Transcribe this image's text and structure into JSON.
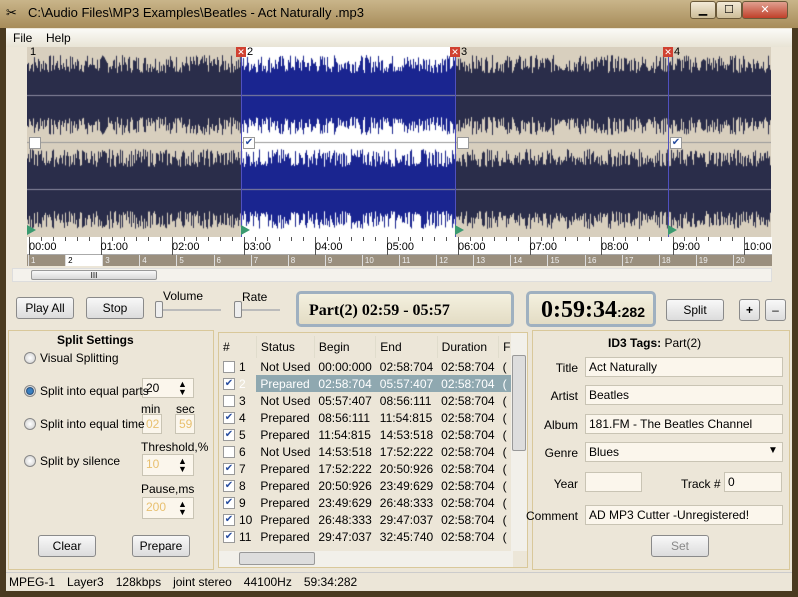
{
  "window": {
    "title": "C:\\Audio Files\\MP3 Examples\\Beatles - Act Naturally .mp3",
    "minimize": "▁",
    "maximize": "☐",
    "close": "✕"
  },
  "menu": [
    "File",
    "Help"
  ],
  "waveform": {
    "markers": [
      "1",
      "2",
      "3",
      "4"
    ],
    "selected_part": 2,
    "time_ticks": [
      "00:00",
      "01:00",
      "02:00",
      "03:00",
      "04:00",
      "05:00",
      "06:00",
      "07:00",
      "08:00",
      "09:00",
      "10:00"
    ],
    "part_ruler": [
      "1",
      "2",
      "3",
      "4",
      "5",
      "6",
      "7",
      "8",
      "9",
      "10",
      "11",
      "12",
      "13",
      "14",
      "15",
      "16",
      "17",
      "18",
      "19",
      "20"
    ],
    "colors": {
      "wave": "#2a2d4a",
      "selected_wave": "#1a2590",
      "bg": "#d8cfbe",
      "selected_bg": "#ffffff"
    }
  },
  "controls": {
    "play_all": "Play All",
    "stop": "Stop",
    "volume": "Volume",
    "rate": "Rate",
    "part_display": "Part(2)  02:59 - 05:57",
    "time_main": "0:59:34",
    "time_ms": ":282",
    "split": "Split",
    "plus": "+",
    "minus": "–"
  },
  "split_settings": {
    "title": "Split Settings",
    "options": [
      "Visual Splitting",
      "Split into equal parts",
      "Split into equal time",
      "Split by silence"
    ],
    "selected": 1,
    "parts": "20",
    "min_label": "min",
    "sec_label": "sec",
    "min": "02",
    "sec": "59",
    "threshold_label": "Threshold,%",
    "threshold": "10",
    "pause_label": "Pause,ms",
    "pause": "200",
    "clear": "Clear",
    "prepare": "Prepare"
  },
  "table": {
    "headers": [
      "#",
      "Status",
      "Begin",
      "End",
      "Duration",
      "F"
    ],
    "rows": [
      {
        "checked": false,
        "n": "1",
        "status": "Not Used",
        "begin": "00:00:000",
        "end": "02:58:704",
        "duration": "02:58:704"
      },
      {
        "checked": true,
        "n": "2",
        "status": "Prepared",
        "begin": "02:58:704",
        "end": "05:57:407",
        "duration": "02:58:704",
        "selected": true
      },
      {
        "checked": false,
        "n": "3",
        "status": "Not Used",
        "begin": "05:57:407",
        "end": "08:56:111",
        "duration": "02:58:704"
      },
      {
        "checked": true,
        "n": "4",
        "status": "Prepared",
        "begin": "08:56:111",
        "end": "11:54:815",
        "duration": "02:58:704"
      },
      {
        "checked": true,
        "n": "5",
        "status": "Prepared",
        "begin": "11:54:815",
        "end": "14:53:518",
        "duration": "02:58:704"
      },
      {
        "checked": false,
        "n": "6",
        "status": "Not Used",
        "begin": "14:53:518",
        "end": "17:52:222",
        "duration": "02:58:704"
      },
      {
        "checked": true,
        "n": "7",
        "status": "Prepared",
        "begin": "17:52:222",
        "end": "20:50:926",
        "duration": "02:58:704"
      },
      {
        "checked": true,
        "n": "8",
        "status": "Prepared",
        "begin": "20:50:926",
        "end": "23:49:629",
        "duration": "02:58:704"
      },
      {
        "checked": true,
        "n": "9",
        "status": "Prepared",
        "begin": "23:49:629",
        "end": "26:48:333",
        "duration": "02:58:704"
      },
      {
        "checked": true,
        "n": "10",
        "status": "Prepared",
        "begin": "26:48:333",
        "end": "29:47:037",
        "duration": "02:58:704"
      },
      {
        "checked": true,
        "n": "11",
        "status": "Prepared",
        "begin": "29:47:037",
        "end": "32:45:740",
        "duration": "02:58:704"
      }
    ]
  },
  "id3": {
    "title": "ID3 Tags:",
    "part": "Part(2)",
    "labels": {
      "title": "Title",
      "artist": "Artist",
      "album": "Album",
      "genre": "Genre",
      "year": "Year",
      "track": "Track #",
      "comment": "Comment"
    },
    "values": {
      "title": "Act Naturally",
      "artist": "Beatles",
      "album": "181.FM - The Beatles Channel",
      "genre": "Blues",
      "year": "",
      "track": "0",
      "comment": "AD MP3 Cutter -Unregistered!"
    },
    "set": "Set"
  },
  "status": [
    "MPEG-1",
    "Layer3",
    "128kbps",
    "joint stereo",
    "44100Hz",
    "59:34:282"
  ]
}
